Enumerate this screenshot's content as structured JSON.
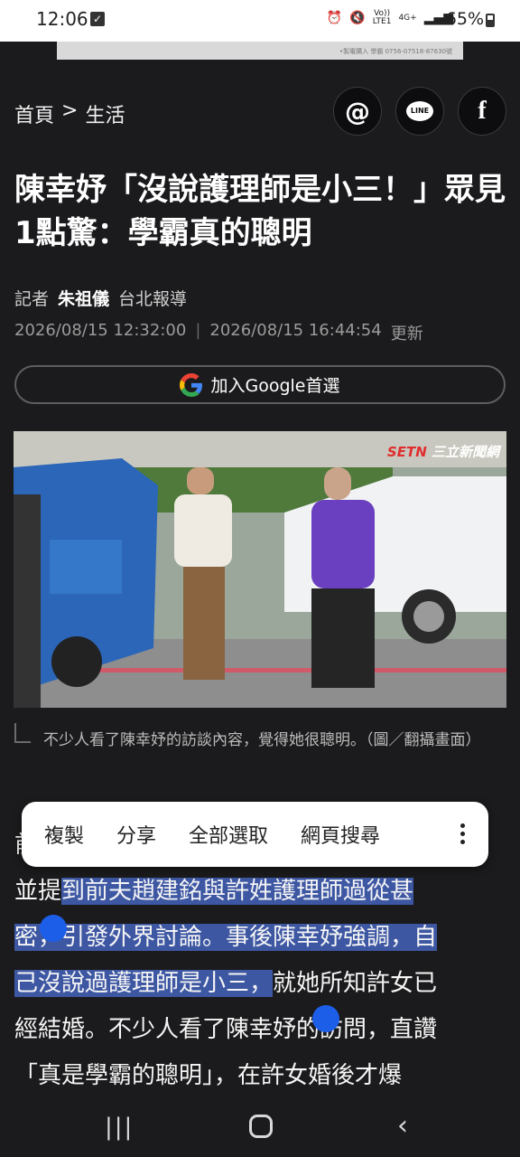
{
  "status_bar": {
    "time": "12:06",
    "network_label_1": "Vo))\nLTE1",
    "network_label_2": "4G+",
    "battery": "65%"
  },
  "ad_strip": {
    "text": "•製電購入 學霸 0756-07518-87630號"
  },
  "breadcrumb": {
    "home": "首頁",
    "separator": ">",
    "section": "生活"
  },
  "social": {
    "threads": "threads-icon",
    "line": "LINE",
    "facebook": "f"
  },
  "headline": "陳幸妤「沒說護理師是小三！」眾見1點驚：學霸真的聰明",
  "byline": {
    "prefix": "記者",
    "author": "朱祖儀",
    "location": "台北報導"
  },
  "dates": {
    "published": "2026/08/15 12:32:00",
    "separator": "|",
    "updated": "2026/08/15 16:44:54",
    "updated_label": "更新"
  },
  "google_button": {
    "label": "加入Google首選"
  },
  "photo": {
    "watermark_brand": "SETN",
    "watermark_text": "三立新聞網"
  },
  "caption": "不少人看了陳幸妤的訪談內容，覺得她很聰明。（圖／翻攝畫面）",
  "selection_menu": {
    "items": [
      "複製",
      "分享",
      "全部選取",
      "網頁搜尋"
    ]
  },
  "article": {
    "line1": "前",
    "line2_plain": "並提",
    "line2_sel": "到前夫趙建銘與許姓護理師過從甚",
    "line3_sel": "密，引發外界討論。事後陳幸妤強調，自",
    "line4_sel": "己沒說過護理師是小三，",
    "line4_plain": "就她所知許女已",
    "line5": "經結婚。不少人看了陳幸妤的訪問，直讚",
    "line6": "「真是學霸的聰明」，在許女婚後才爆"
  },
  "colors": {
    "background": "#1b1b1d",
    "selection": "#3d57a3",
    "handle": "#1c5ee8"
  }
}
